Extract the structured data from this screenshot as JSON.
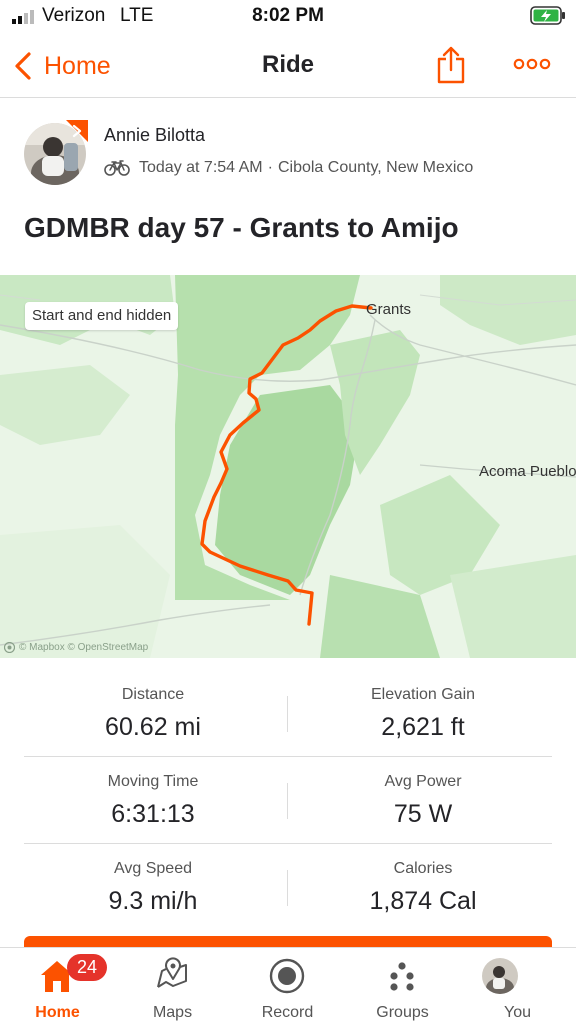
{
  "status_bar": {
    "carrier": "Verizon",
    "network": "LTE",
    "time": "8:02 PM",
    "battery_icon": "battery-charging-icon"
  },
  "nav": {
    "back_label": "Home",
    "title": "Ride",
    "share_icon": "share-icon",
    "more_icon": "more-icon"
  },
  "activity": {
    "athlete_name": "Annie Bilotta",
    "sport_icon": "bike-icon",
    "date_time": "Today at 7:54 AM",
    "separator": "·",
    "location": "Cibola County, New Mexico",
    "title": "GDMBR day 57 - Grants to Amijo"
  },
  "map": {
    "privacy_label": "Start and end hidden",
    "places": [
      "Grants",
      "Acoma Pueblo"
    ],
    "attribution": "© Mapbox © OpenStreetMap",
    "route_color": "#fc5200"
  },
  "stats": [
    {
      "label": "Distance",
      "value": "60.62 mi"
    },
    {
      "label": "Elevation Gain",
      "value": "2,621 ft"
    },
    {
      "label": "Moving Time",
      "value": "6:31:13"
    },
    {
      "label": "Avg Power",
      "value": "75 W"
    },
    {
      "label": "Avg Speed",
      "value": "9.3 mi/h"
    },
    {
      "label": "Calories",
      "value": "1,874 Cal"
    }
  ],
  "tabbar": {
    "tabs": [
      {
        "label": "Home",
        "icon": "home-icon",
        "active": true,
        "badge": "24"
      },
      {
        "label": "Maps",
        "icon": "maps-icon"
      },
      {
        "label": "Record",
        "icon": "record-icon"
      },
      {
        "label": "Groups",
        "icon": "groups-icon"
      },
      {
        "label": "You",
        "icon": "avatar"
      }
    ]
  },
  "colors": {
    "accent": "#fc5200",
    "badge": "#e5332a",
    "battery": "#2fb344"
  }
}
